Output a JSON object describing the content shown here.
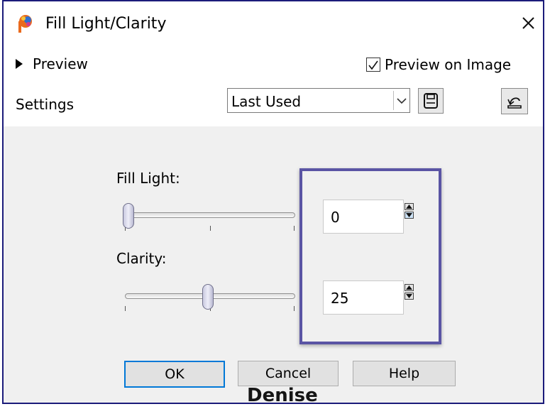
{
  "dialog": {
    "title": "Fill Light/Clarity",
    "close_icon": "close-icon"
  },
  "preview": {
    "toggle_label": "Preview",
    "on_image_label": "Preview on Image",
    "on_image_checked": true
  },
  "settings": {
    "label": "Settings",
    "preset_value": "Last Used"
  },
  "fill_light": {
    "label": "Fill Light:",
    "value": "0",
    "level": 0
  },
  "clarity": {
    "label": "Clarity:",
    "value": "25",
    "level": 0.5
  },
  "buttons": {
    "ok": "OK",
    "cancel": "Cancel",
    "help": "Help"
  },
  "watermark": "Denise",
  "colors": {
    "frame": "#1b1b7a",
    "highlight": "#5a54a4",
    "default_button_border": "#0078d7"
  }
}
